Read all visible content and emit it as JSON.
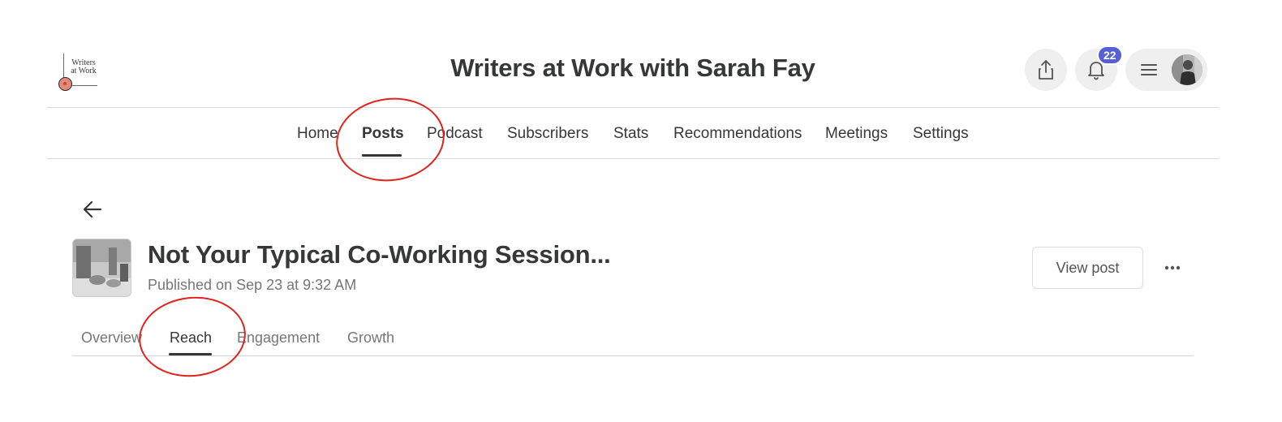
{
  "header": {
    "logo_text": "Writers at Work",
    "site_title": "Writers at Work with Sarah Fay",
    "notification_count": "22",
    "icons": [
      "share-icon",
      "bell-icon",
      "hamburger-menu-icon",
      "avatar"
    ]
  },
  "nav": {
    "items": [
      {
        "label": "Home"
      },
      {
        "label": "Posts",
        "active": true
      },
      {
        "label": "Podcast"
      },
      {
        "label": "Subscribers"
      },
      {
        "label": "Stats"
      },
      {
        "label": "Recommendations"
      },
      {
        "label": "Meetings"
      },
      {
        "label": "Settings"
      }
    ]
  },
  "post": {
    "title": "Not Your Typical Co-Working Session...",
    "meta": "Published on Sep 23 at 9:32 AM",
    "view_post_label": "View post"
  },
  "tabs": {
    "items": [
      {
        "label": "Overview"
      },
      {
        "label": "Reach",
        "active": true
      },
      {
        "label": "Engagement"
      },
      {
        "label": "Growth"
      }
    ]
  },
  "colors": {
    "text": "#363737",
    "muted": "#777777",
    "badge": "#5660d3",
    "annotation": "#e0231b",
    "button_bg": "#efefef"
  }
}
